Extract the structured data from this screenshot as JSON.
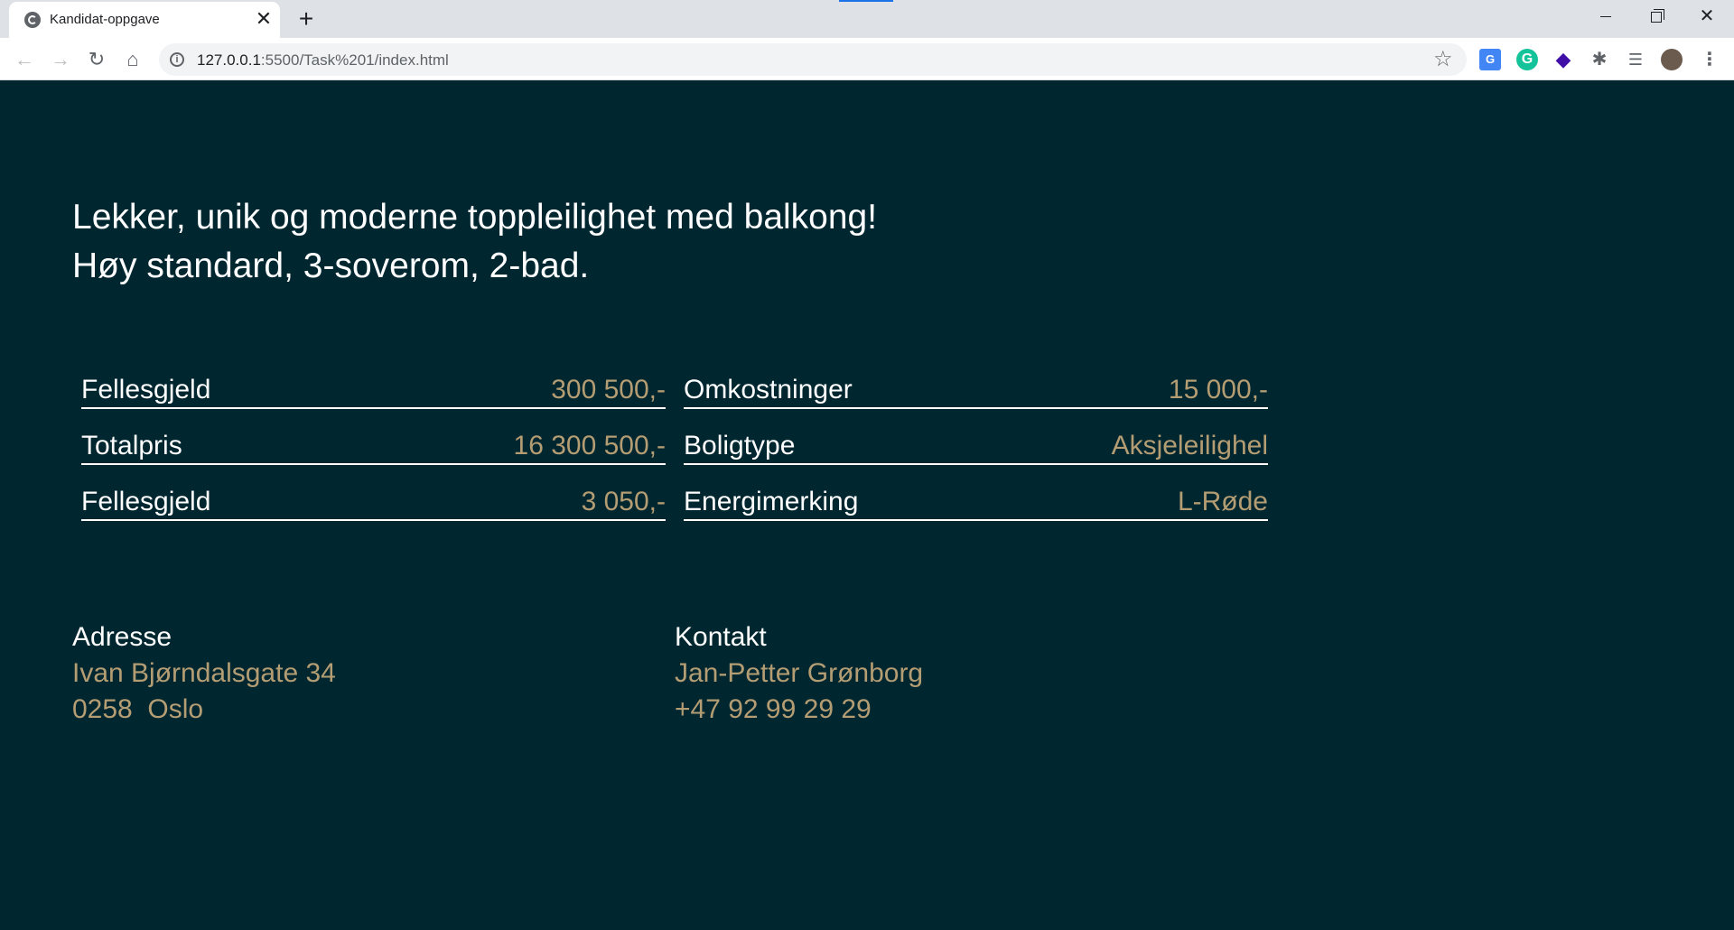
{
  "browser": {
    "tab_title": "Kandidat-oppgave",
    "tab_close": "✕",
    "new_tab": "+",
    "url_host": "127.0.0.1",
    "url_path": ":5500/Task%201/index.html",
    "icons": [
      "globe-icon",
      "close-icon",
      "plus-icon",
      "back-arrow-icon",
      "forward-arrow-icon",
      "reload-icon",
      "home-icon",
      "info-icon",
      "star-icon",
      "google-translate-icon",
      "grammarly-icon",
      "layers-icon",
      "puzzle-icon",
      "media-queue-icon",
      "avatar-icon",
      "kebab-menu-icon"
    ]
  },
  "listing": {
    "headline_line1": "Lekker, unik og moderne toppleilighet med balkong!",
    "headline_line2": "Høy standard, 3-soverom, 2-bad.",
    "details": [
      {
        "label": "Fellesgjeld",
        "value": "300 500,-"
      },
      {
        "label": "Omkostninger",
        "value": "15 000,-"
      },
      {
        "label": "Totalpris",
        "value": "16 300 500,-"
      },
      {
        "label": "Boligtype",
        "value": "Aksjeleilighel"
      },
      {
        "label": "Fellesgjeld",
        "value": "3 050,-"
      },
      {
        "label": "Energimerking",
        "value": "L-Røde"
      }
    ],
    "address": {
      "heading": "Adresse",
      "street": "Ivan Bjørndalsgate 34",
      "postal": "0258  Oslo"
    },
    "contact": {
      "heading": "Kontakt",
      "name": "Jan-Petter Grønborg",
      "phone": "+47 92 99 29 29"
    }
  },
  "colors": {
    "background": "#002630",
    "text": "#ffffff",
    "accent": "#b49d73"
  }
}
